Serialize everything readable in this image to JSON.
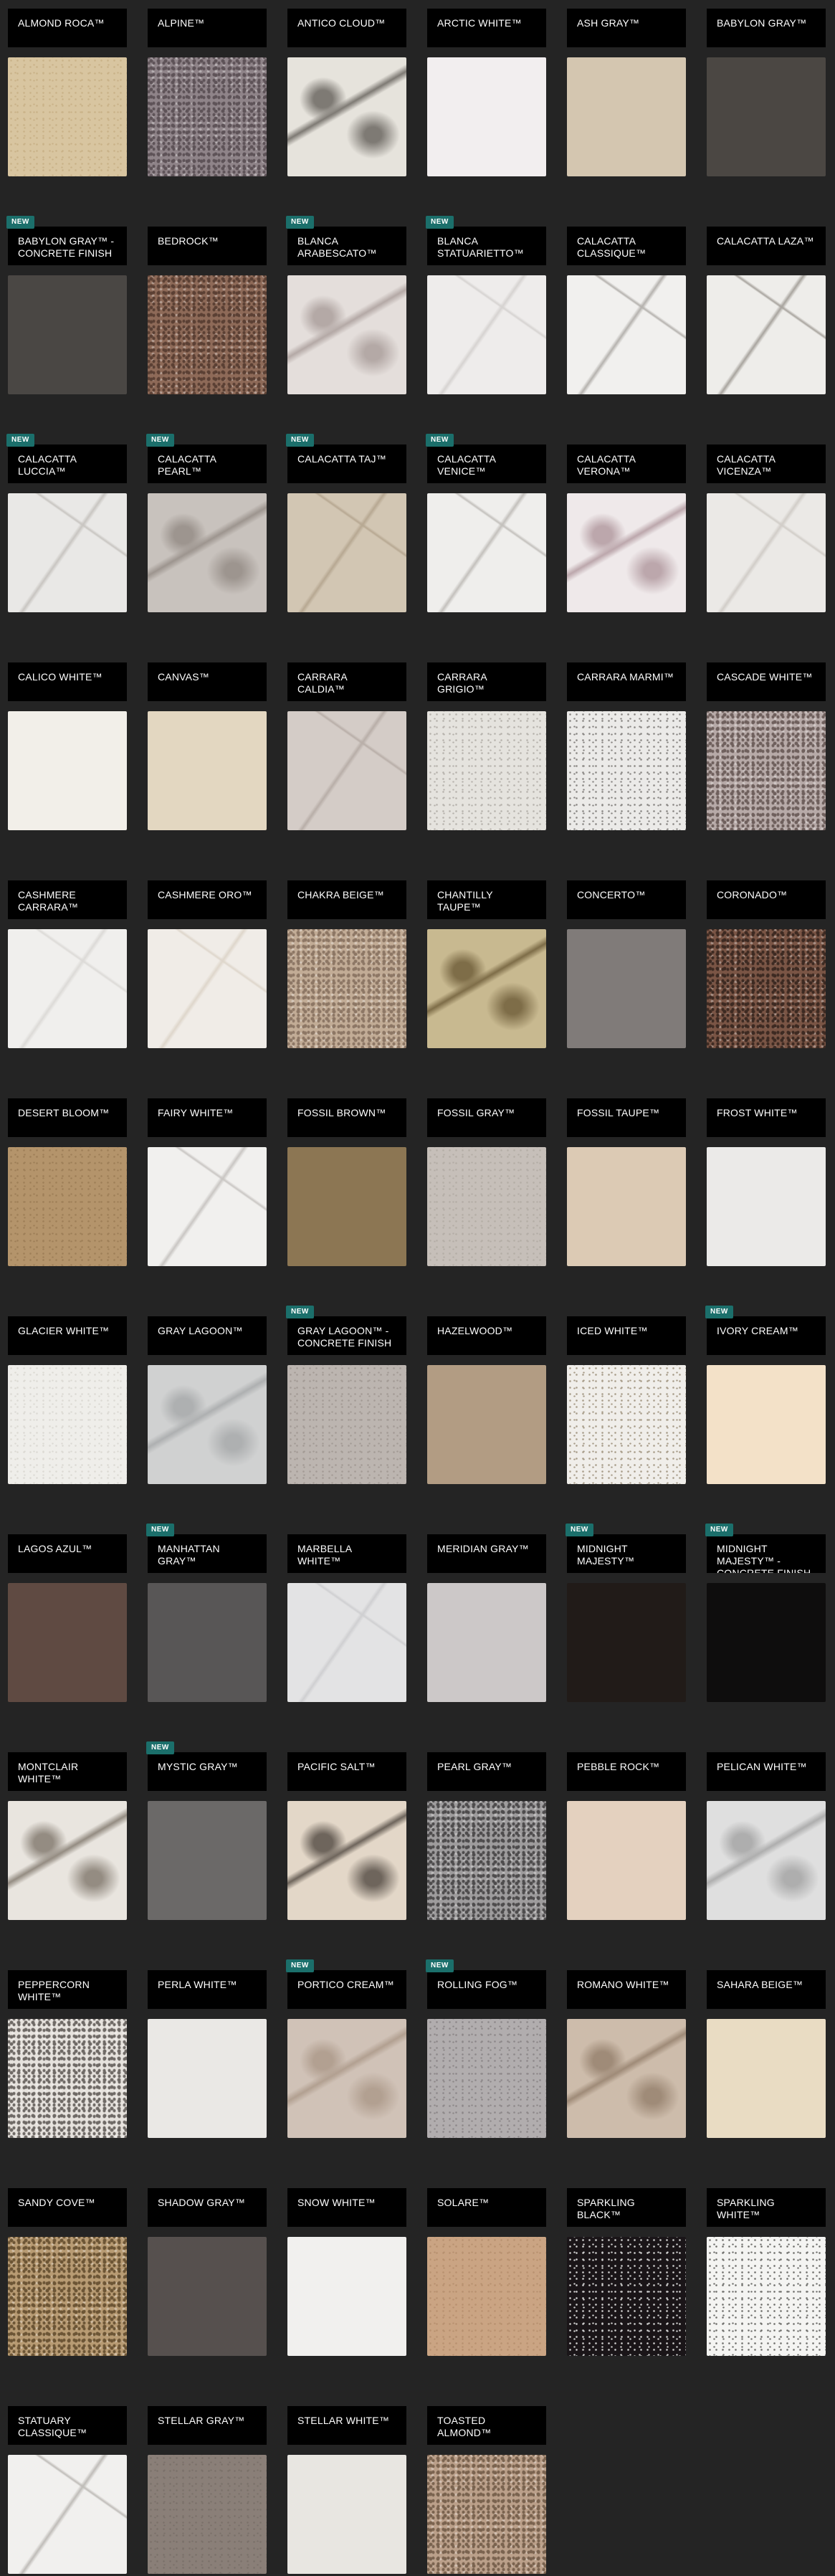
{
  "badge_label": "NEW",
  "colors": {
    "page_background": "#242424",
    "label_background": "#000000",
    "label_text": "#ffffff",
    "badge_background": "#1b6f6b"
  },
  "products": [
    {
      "name": "ALMOND ROCA™",
      "new": false,
      "swatch": {
        "base": "#d8c5a0",
        "accent": "#c9b288",
        "pattern": "speckle"
      }
    },
    {
      "name": "ALPINE™",
      "new": false,
      "swatch": {
        "base": "#8f8489",
        "accent": "#5e5358",
        "pattern": "granite"
      }
    },
    {
      "name": "ANTICO CLOUD™",
      "new": false,
      "swatch": {
        "base": "#e6e3dc",
        "accent": "#7e7a74",
        "pattern": "swirl"
      }
    },
    {
      "name": "ARCTIC WHITE™",
      "new": false,
      "swatch": {
        "base": "#f2eeef",
        "accent": "#e8e3e4",
        "pattern": "solid"
      }
    },
    {
      "name": "ASH GRAY™",
      "new": false,
      "swatch": {
        "base": "#d4c6b0",
        "accent": "#c8b89f",
        "pattern": "solid"
      }
    },
    {
      "name": "BABYLON GRAY™",
      "new": false,
      "swatch": {
        "base": "#4b4743",
        "accent": "#5b5652",
        "pattern": "solid"
      }
    },
    {
      "name": "BABYLON GRAY™ - CONCRETE FINISH",
      "new": true,
      "swatch": {
        "base": "#4a4744",
        "accent": "#3e3b39",
        "pattern": "solid"
      }
    },
    {
      "name": "BEDROCK™",
      "new": false,
      "swatch": {
        "base": "#8e6a58",
        "accent": "#5b4034",
        "pattern": "granite"
      }
    },
    {
      "name": "BLANCA ARABESCATO™",
      "new": true,
      "swatch": {
        "base": "#e4dedb",
        "accent": "#b4a9a6",
        "pattern": "swirl"
      }
    },
    {
      "name": "BLANCA STATUARIETTO™",
      "new": true,
      "swatch": {
        "base": "#eeeceb",
        "accent": "#d6d3d1",
        "pattern": "vein"
      }
    },
    {
      "name": "CALACATTA CLASSIQUE™",
      "new": false,
      "swatch": {
        "base": "#f1f0ee",
        "accent": "#b5b2ae",
        "pattern": "vein"
      }
    },
    {
      "name": "CALACATTA LAZA™",
      "new": false,
      "swatch": {
        "base": "#eeedea",
        "accent": "#a8a49e",
        "pattern": "vein"
      }
    },
    {
      "name": "CALACATTA LUCCIA™",
      "new": true,
      "swatch": {
        "base": "#e9e8e6",
        "accent": "#c8c5c1",
        "pattern": "vein"
      }
    },
    {
      "name": "CALACATTA PEARL™",
      "new": true,
      "swatch": {
        "base": "#c8c2bd",
        "accent": "#9d958f",
        "pattern": "swirl"
      }
    },
    {
      "name": "CALACATTA TAJ™",
      "new": true,
      "swatch": {
        "base": "#d2c6b3",
        "accent": "#b7a892",
        "pattern": "vein"
      }
    },
    {
      "name": "CALACATTA VENICE™",
      "new": true,
      "swatch": {
        "base": "#efeeec",
        "accent": "#c3c0bc",
        "pattern": "vein"
      }
    },
    {
      "name": "CALACATTA VERONA™",
      "new": false,
      "swatch": {
        "base": "#efe9ea",
        "accent": "#bca7ac",
        "pattern": "swirl"
      }
    },
    {
      "name": "CALACATTA VICENZA™",
      "new": false,
      "swatch": {
        "base": "#ebe9e6",
        "accent": "#d1cdc8",
        "pattern": "vein"
      }
    },
    {
      "name": "CALICO WHITE™",
      "new": false,
      "swatch": {
        "base": "#f2efe9",
        "accent": "#e3dfd8",
        "pattern": "solid"
      }
    },
    {
      "name": "CANVAS™",
      "new": false,
      "swatch": {
        "base": "#e3d7c1",
        "accent": "#d8cab1",
        "pattern": "solid"
      }
    },
    {
      "name": "CARRARA CALDIA™",
      "new": false,
      "swatch": {
        "base": "#d4ccc7",
        "accent": "#b8aea8",
        "pattern": "vein"
      }
    },
    {
      "name": "CARRARA GRIGIO™",
      "new": false,
      "swatch": {
        "base": "#e5e3de",
        "accent": "#b7b3ad",
        "pattern": "speckle"
      }
    },
    {
      "name": "CARRARA MARMI™",
      "new": false,
      "swatch": {
        "base": "#ebeae8",
        "accent": "#8a8784",
        "pattern": "speckle"
      }
    },
    {
      "name": "CASCADE WHITE™",
      "new": false,
      "swatch": {
        "base": "#b7aaa8",
        "accent": "#6f605d",
        "pattern": "granite"
      }
    },
    {
      "name": "CASHMERE CARRARA™",
      "new": false,
      "swatch": {
        "base": "#f0efed",
        "accent": "#dcdad7",
        "pattern": "vein"
      }
    },
    {
      "name": "CASHMERE ORO™",
      "new": false,
      "swatch": {
        "base": "#f0ece7",
        "accent": "#ded6cb",
        "pattern": "vein"
      }
    },
    {
      "name": "CHAKRA BEIGE™",
      "new": false,
      "swatch": {
        "base": "#c2ac96",
        "accent": "#8d7765",
        "pattern": "granite"
      }
    },
    {
      "name": "CHANTILLY TAUPE™",
      "new": false,
      "swatch": {
        "base": "#c8b990",
        "accent": "#7e6d48",
        "pattern": "swirl"
      }
    },
    {
      "name": "CONCERTO™",
      "new": false,
      "swatch": {
        "base": "#807b79",
        "accent": "#74706e",
        "pattern": "solid"
      }
    },
    {
      "name": "CORONADO™",
      "new": false,
      "swatch": {
        "base": "#7a5545",
        "accent": "#3d2a22",
        "pattern": "granite"
      }
    },
    {
      "name": "DESERT BLOOM™",
      "new": false,
      "swatch": {
        "base": "#b4946b",
        "accent": "#9e7f58",
        "pattern": "speckle"
      }
    },
    {
      "name": "FAIRY WHITE™",
      "new": false,
      "swatch": {
        "base": "#f1f0ee",
        "accent": "#c9c6c3",
        "pattern": "vein"
      }
    },
    {
      "name": "FOSSIL BROWN™",
      "new": false,
      "swatch": {
        "base": "#8c7653",
        "accent": "#7b6648",
        "pattern": "solid"
      }
    },
    {
      "name": "FOSSIL GRAY™",
      "new": false,
      "swatch": {
        "base": "#c6bfb9",
        "accent": "#b4ada6",
        "pattern": "speckle"
      }
    },
    {
      "name": "FOSSIL TAUPE™",
      "new": false,
      "swatch": {
        "base": "#dccab4",
        "accent": "#cdb9a1",
        "pattern": "solid"
      }
    },
    {
      "name": "FROST WHITE™",
      "new": false,
      "swatch": {
        "base": "#ebeae8",
        "accent": "#dedcd9",
        "pattern": "solid"
      }
    },
    {
      "name": "GLACIER WHITE™",
      "new": false,
      "swatch": {
        "base": "#efeeea",
        "accent": "#dcdad4",
        "pattern": "speckle"
      }
    },
    {
      "name": "GRAY LAGOON™",
      "new": false,
      "swatch": {
        "base": "#d0d1d1",
        "accent": "#aeb0b1",
        "pattern": "swirl"
      }
    },
    {
      "name": "GRAY LAGOON™ - CONCRETE FINISH",
      "new": true,
      "swatch": {
        "base": "#bcb5b0",
        "accent": "#a39b95",
        "pattern": "speckle"
      }
    },
    {
      "name": "HAZELWOOD™",
      "new": false,
      "swatch": {
        "base": "#b29c83",
        "accent": "#a58f76",
        "pattern": "solid"
      }
    },
    {
      "name": "ICED WHITE™",
      "new": false,
      "swatch": {
        "base": "#f0eeea",
        "accent": "#a89d8a",
        "pattern": "speckle"
      }
    },
    {
      "name": "IVORY CREAM™",
      "new": true,
      "swatch": {
        "base": "#f3e1c8",
        "accent": "#ecd6ba",
        "pattern": "solid"
      }
    },
    {
      "name": "LAGOS AZUL™",
      "new": false,
      "swatch": {
        "base": "#5f4a42",
        "accent": "#51403a",
        "pattern": "solid"
      }
    },
    {
      "name": "MANHATTAN GRAY™",
      "new": true,
      "swatch": {
        "base": "#585656",
        "accent": "#4d4b4b",
        "pattern": "solid"
      }
    },
    {
      "name": "MARBELLA WHITE™",
      "new": false,
      "swatch": {
        "base": "#e3e3e4",
        "accent": "#cfcfd1",
        "pattern": "vein"
      }
    },
    {
      "name": "MERIDIAN GRAY™",
      "new": false,
      "swatch": {
        "base": "#ccc8c8",
        "accent": "#c0bbbb",
        "pattern": "solid"
      }
    },
    {
      "name": "MIDNIGHT MAJESTY™",
      "new": true,
      "swatch": {
        "base": "#211b18",
        "accent": "#2c2420",
        "pattern": "solid"
      }
    },
    {
      "name": "MIDNIGHT MAJESTY™ - CONCRETE FINISH",
      "new": true,
      "swatch": {
        "base": "#0e0d0d",
        "accent": "#1a1818",
        "pattern": "solid"
      }
    },
    {
      "name": "MONTCLAIR WHITE™",
      "new": false,
      "swatch": {
        "base": "#e9e5df",
        "accent": "#948c82",
        "pattern": "swirl"
      }
    },
    {
      "name": "MYSTIC GRAY™",
      "new": true,
      "swatch": {
        "base": "#6b6968",
        "accent": "#5f5d5c",
        "pattern": "solid"
      }
    },
    {
      "name": "PACIFIC SALT™",
      "new": false,
      "swatch": {
        "base": "#e3d7c8",
        "accent": "#6e655c",
        "pattern": "swirl"
      }
    },
    {
      "name": "PEARL GRAY™",
      "new": false,
      "swatch": {
        "base": "#9e9c9d",
        "accent": "#4e4c4d",
        "pattern": "granite"
      }
    },
    {
      "name": "PEBBLE ROCK™",
      "new": false,
      "swatch": {
        "base": "#e4d1bf",
        "accent": "#d6c1ad",
        "pattern": "solid"
      }
    },
    {
      "name": "PELICAN WHITE™",
      "new": false,
      "swatch": {
        "base": "#dfdfdf",
        "accent": "#aeaeae",
        "pattern": "swirl"
      }
    },
    {
      "name": "PEPPERCORN WHITE™",
      "new": false,
      "swatch": {
        "base": "#e6e2dd",
        "accent": "#6f6a66",
        "pattern": "granite"
      }
    },
    {
      "name": "PERLA WHITE™",
      "new": false,
      "swatch": {
        "base": "#eae8e5",
        "accent": "#dfdcd8",
        "pattern": "solid"
      }
    },
    {
      "name": "PORTICO CREAM™",
      "new": true,
      "swatch": {
        "base": "#d0c2b7",
        "accent": "#b2a091",
        "pattern": "swirl"
      }
    },
    {
      "name": "ROLLING FOG™",
      "new": true,
      "swatch": {
        "base": "#b1adae",
        "accent": "#8d8889",
        "pattern": "speckle"
      }
    },
    {
      "name": "ROMANO WHITE™",
      "new": false,
      "swatch": {
        "base": "#cdbcab",
        "accent": "#9f8b78",
        "pattern": "swirl"
      }
    },
    {
      "name": "SAHARA BEIGE™",
      "new": false,
      "swatch": {
        "base": "#e9dcc3",
        "accent": "#dfd0b3",
        "pattern": "solid"
      }
    },
    {
      "name": "SANDY COVE™",
      "new": false,
      "swatch": {
        "base": "#b89b73",
        "accent": "#6c5535",
        "pattern": "granite"
      }
    },
    {
      "name": "SHADOW GRAY™",
      "new": false,
      "swatch": {
        "base": "#56504e",
        "accent": "#4b4543",
        "pattern": "solid"
      }
    },
    {
      "name": "SNOW WHITE™",
      "new": false,
      "swatch": {
        "base": "#f1f0ee",
        "accent": "#e9e7e4",
        "pattern": "solid"
      }
    },
    {
      "name": "SOLARE™",
      "new": false,
      "swatch": {
        "base": "#caa483",
        "accent": "#b89170",
        "pattern": "speckle"
      }
    },
    {
      "name": "SPARKLING BLACK™",
      "new": false,
      "swatch": {
        "base": "#1a1518",
        "accent": "#cfcfcf",
        "pattern": "speckle"
      }
    },
    {
      "name": "SPARKLING WHITE™",
      "new": false,
      "swatch": {
        "base": "#f4f4f2",
        "accent": "#6f6f6c",
        "pattern": "speckle"
      }
    },
    {
      "name": "STATUARY CLASSIQUE™",
      "new": false,
      "swatch": {
        "base": "#f1f0ee",
        "accent": "#bfbcb8",
        "pattern": "vein"
      }
    },
    {
      "name": "STELLAR GRAY™",
      "new": false,
      "swatch": {
        "base": "#8a7f78",
        "accent": "#7b716a",
        "pattern": "speckle"
      }
    },
    {
      "name": "STELLAR WHITE™",
      "new": false,
      "swatch": {
        "base": "#e8e6e1",
        "accent": "#dcd9d3",
        "pattern": "solid"
      }
    },
    {
      "name": "TOASTED ALMOND™",
      "new": false,
      "swatch": {
        "base": "#bba08a",
        "accent": "#7a634f",
        "pattern": "granite"
      }
    }
  ]
}
